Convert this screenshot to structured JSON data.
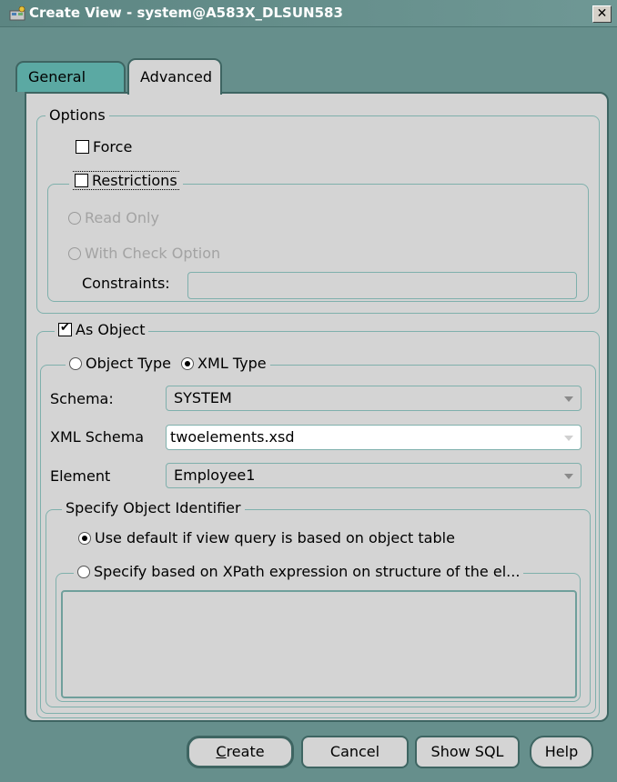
{
  "window": {
    "title": "Create View - system@A583X_DLSUN583",
    "close_label": "✕"
  },
  "tabs": [
    {
      "label": "General",
      "selected": false
    },
    {
      "label": "Advanced",
      "selected": true
    }
  ],
  "options": {
    "legend": "Options",
    "force_label": "Force",
    "force_checked": false,
    "restrictions_label": "Restrictions",
    "restrictions_checked": false,
    "read_only_label": "Read Only",
    "with_check_label": "With Check Option",
    "constraints_label": "Constraints:",
    "constraints_value": ""
  },
  "as_object": {
    "label": "As Object",
    "checked": true,
    "object_type_label": "Object Type",
    "xml_type_label": "XML Type",
    "selected_type": "XML Type",
    "schema_label": "Schema:",
    "schema_value": "SYSTEM",
    "xml_schema_label": "XML Schema",
    "xml_schema_value": "twoelements.xsd",
    "element_label": "Element",
    "element_value": "Employee1"
  },
  "identifier": {
    "legend": "Specify Object Identifier",
    "default_option": "Use default if view query is based on object table",
    "xpath_option": "Specify based on XPath expression on structure of the el...",
    "selected": "default",
    "xpath_value": ""
  },
  "buttons": {
    "create": "Create",
    "cancel": "Cancel",
    "show_sql": "Show SQL",
    "help": "Help"
  },
  "colors": {
    "window_bg": "#668f8c",
    "panel_bg": "#d4d4d4",
    "tab_inactive": "#5ba9a3",
    "group_border": "#7fb0ac"
  }
}
